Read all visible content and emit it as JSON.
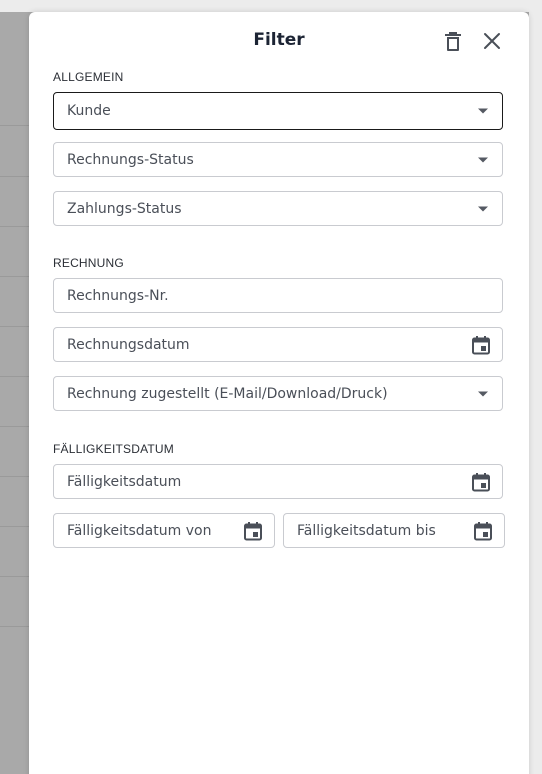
{
  "panel": {
    "title": "Filter",
    "trash_icon": "trash-icon",
    "close_icon": "close-icon"
  },
  "sections": {
    "allgemein": {
      "label": "ALLGEMEIN",
      "fields": {
        "kunde": "Kunde",
        "rechnungs_status": "Rechnungs-Status",
        "zahlungs_status": "Zahlungs-Status"
      }
    },
    "rechnung": {
      "label": "RECHNUNG",
      "fields": {
        "rechnungs_nr": "Rechnungs-Nr.",
        "rechnungsdatum": "Rechnungsdatum",
        "zugestellt": "Rechnung zugestellt (E-Mail/Download/Druck)"
      }
    },
    "faelligkeit": {
      "label": "FÄLLIGKEITSDATUM",
      "fields": {
        "faelligkeitsdatum": "Fälligkeitsdatum",
        "von": "Fälligkeitsdatum von",
        "bis": "Fälligkeitsdatum bis"
      }
    }
  },
  "colors": {
    "text": "#4a4f58",
    "title": "#1c2434",
    "border": "#c9cbd0",
    "focus_border": "#1a1a1a",
    "overlay": "#a9a9a9"
  }
}
